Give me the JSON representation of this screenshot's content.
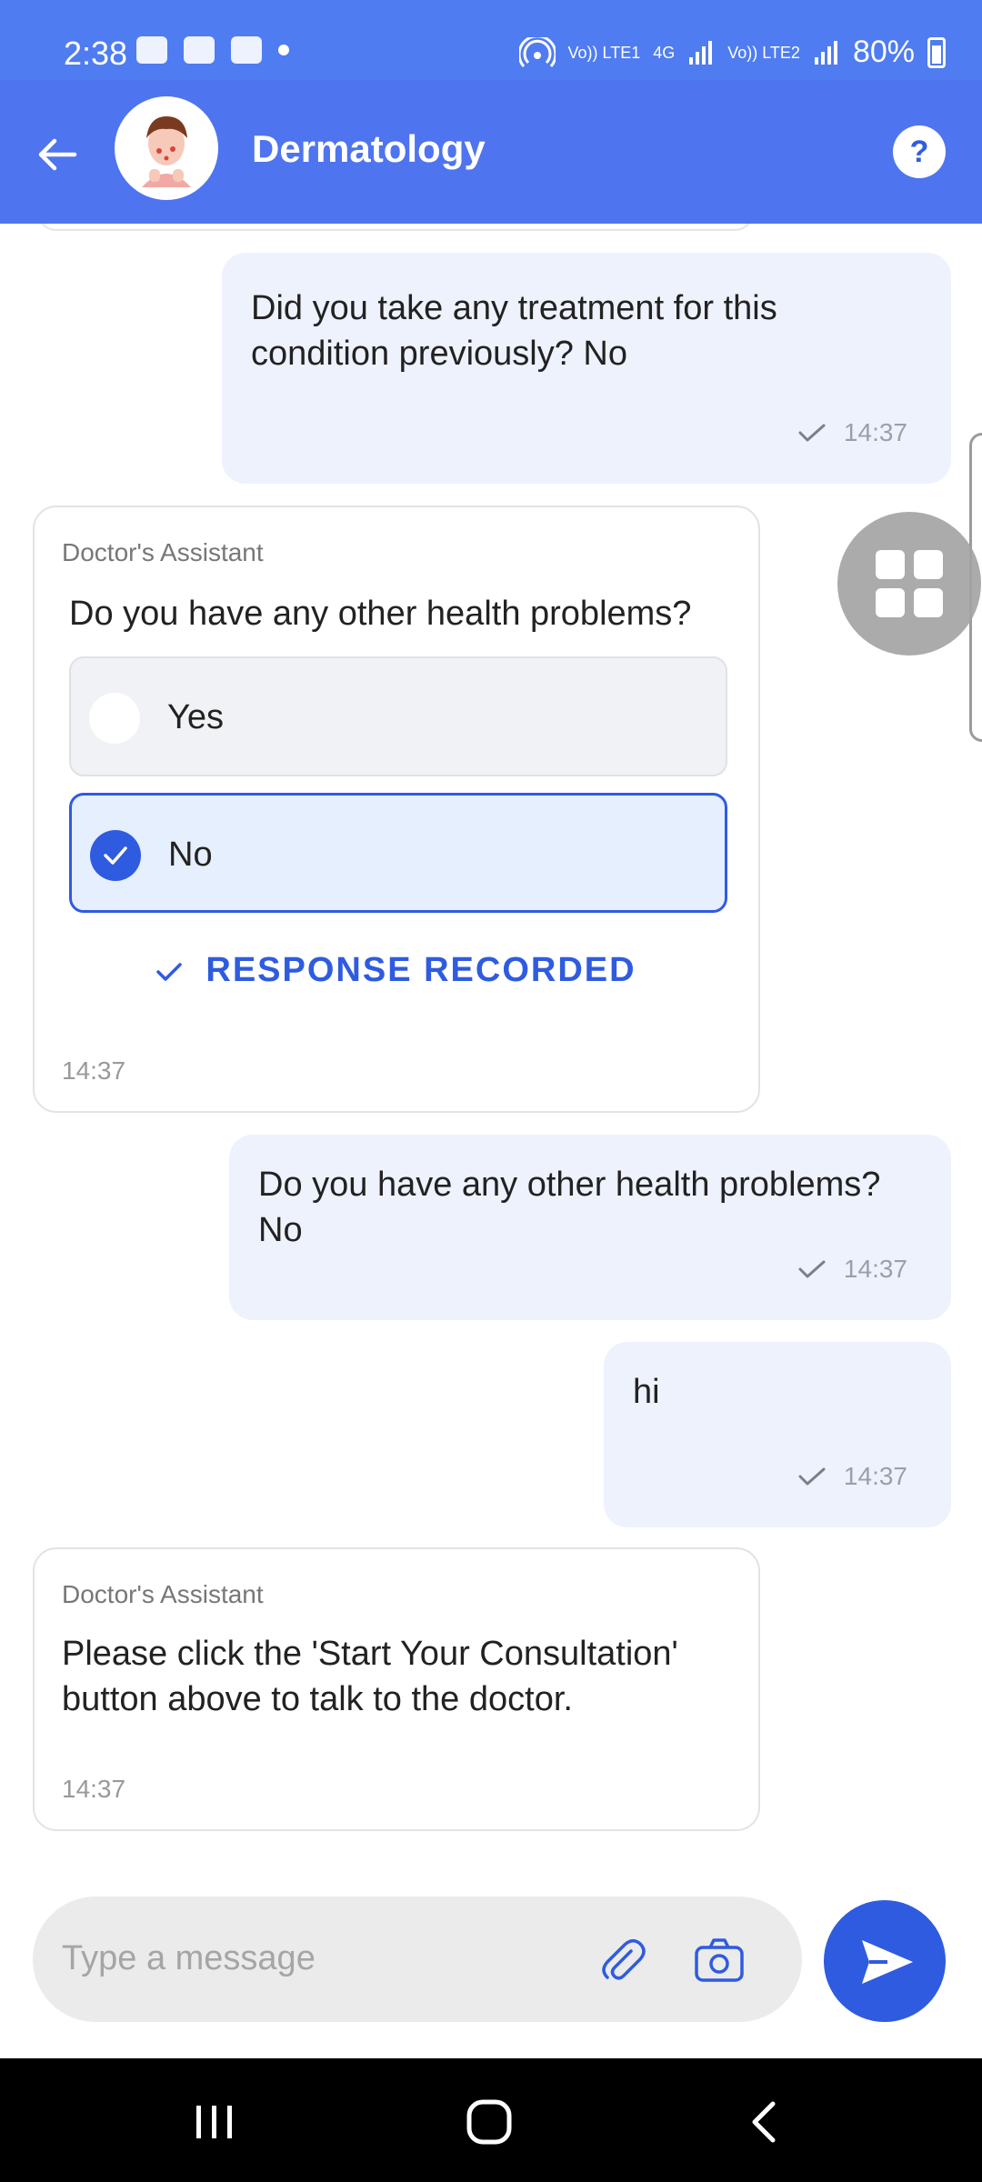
{
  "status_bar": {
    "time": "2:38",
    "network_1": "Vo)) LTE1",
    "network_2": "4G",
    "network_3": "Vo)) LTE2",
    "battery": "80%"
  },
  "header": {
    "title": "Dermatology",
    "help_label": "?"
  },
  "messages": {
    "m1": {
      "text": "Did you take any treatment for this condition previously? No",
      "time": "14:37"
    },
    "m2": {
      "sender": "Doctor's Assistant",
      "question": "Do you have any other health problems?",
      "options": [
        {
          "label": "Yes",
          "selected": false
        },
        {
          "label": "No",
          "selected": true
        }
      ],
      "status": "RESPONSE RECORDED",
      "time": "14:37"
    },
    "m3": {
      "text": "Do you have any other health problems? No",
      "time": "14:37"
    },
    "m4": {
      "text": "hi",
      "time": "14:37"
    },
    "m5": {
      "sender": "Doctor's Assistant",
      "text": "Please click the 'Start Your Consultation' button above to talk to the doctor.",
      "time": "14:37"
    }
  },
  "composer": {
    "placeholder": "Type a message"
  },
  "colors": {
    "primary": "#2f5be0",
    "header": "#4f74ef",
    "outgoing_bubble": "#eef2fd"
  }
}
